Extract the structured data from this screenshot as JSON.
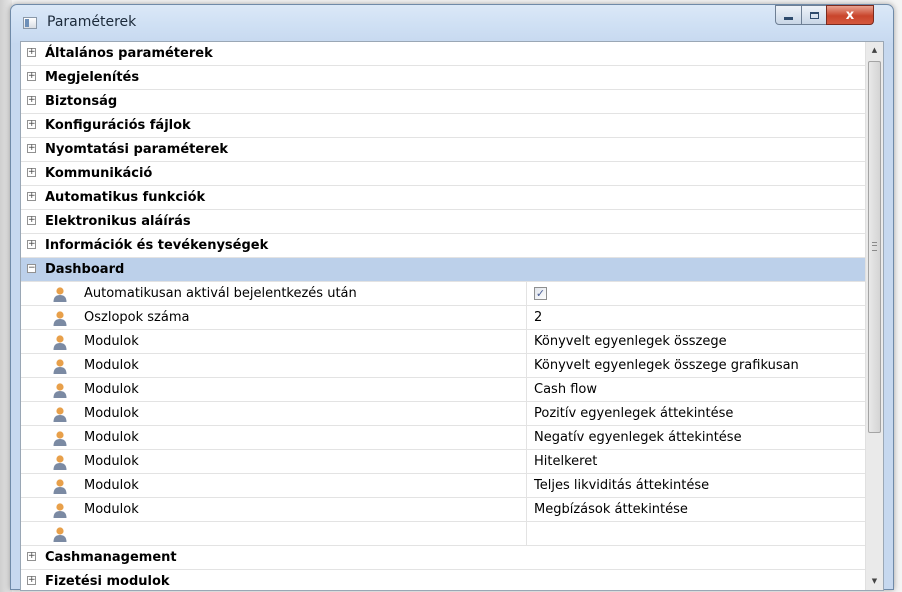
{
  "window": {
    "title": "Paraméterek",
    "controls": {
      "minimize": "minimize",
      "maximize": "maximize",
      "close": "x"
    }
  },
  "categories_top": [
    {
      "label": "Általános paraméterek",
      "toggle": "+"
    },
    {
      "label": "Megjelenítés",
      "toggle": "+"
    },
    {
      "label": "Biztonság",
      "toggle": "+"
    },
    {
      "label": "Konfigurációs fájlok",
      "toggle": "+"
    },
    {
      "label": "Nyomtatási paraméterek",
      "toggle": "+"
    },
    {
      "label": "Kommunikáció",
      "toggle": "+"
    },
    {
      "label": "Automatikus funkciók",
      "toggle": "+"
    },
    {
      "label": "Elektronikus aláírás",
      "toggle": "+"
    },
    {
      "label": "Információk és tevékenységek",
      "toggle": "+"
    }
  ],
  "dashboard": {
    "label": "Dashboard",
    "toggle": "−",
    "properties": [
      {
        "name": "Automatikusan aktivál bejelentkezés után",
        "checked": true
      },
      {
        "name": "Oszlopok száma",
        "value": "2"
      },
      {
        "name": "Modulok",
        "value": "Könyvelt egyenlegek összege"
      },
      {
        "name": "Modulok",
        "value": "Könyvelt egyenlegek összege grafikusan"
      },
      {
        "name": "Modulok",
        "value": "Cash flow"
      },
      {
        "name": "Modulok",
        "value": "Pozitív egyenlegek áttekintése"
      },
      {
        "name": "Modulok",
        "value": "Negatív egyenlegek áttekintése"
      },
      {
        "name": "Modulok",
        "value": "Hitelkeret"
      },
      {
        "name": "Modulok",
        "value": "Teljes likviditás áttekintése"
      },
      {
        "name": "Modulok",
        "value": "Megbízások áttekintése"
      }
    ]
  },
  "categories_bottom": [
    {
      "label": "Cashmanagement",
      "toggle": "+"
    },
    {
      "label": "Fizetési modulok",
      "toggle": "+"
    }
  ],
  "scrollbar": {
    "up_arrow": "▲",
    "down_arrow": "▼"
  },
  "icons": {
    "property_icon": "user-icon"
  }
}
